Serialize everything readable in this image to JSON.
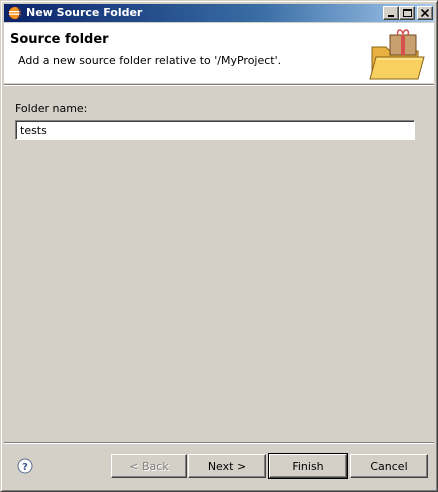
{
  "window": {
    "title": "New Source Folder"
  },
  "header": {
    "title": "Source folder",
    "description": "Add a new source folder relative to '/MyProject'.",
    "graphic_icon": "folder-package-icon"
  },
  "form": {
    "folder_label": "Folder name:",
    "folder_value": "tests"
  },
  "buttons": {
    "back": "< Back",
    "next": "Next >",
    "finish": "Finish",
    "cancel": "Cancel"
  },
  "icons": {
    "app": "eclipse-icon",
    "help": "help-icon"
  },
  "colors": {
    "titlebar_start": "#0a246a",
    "titlebar_end": "#a6caf0",
    "face": "#d4d0c8"
  }
}
